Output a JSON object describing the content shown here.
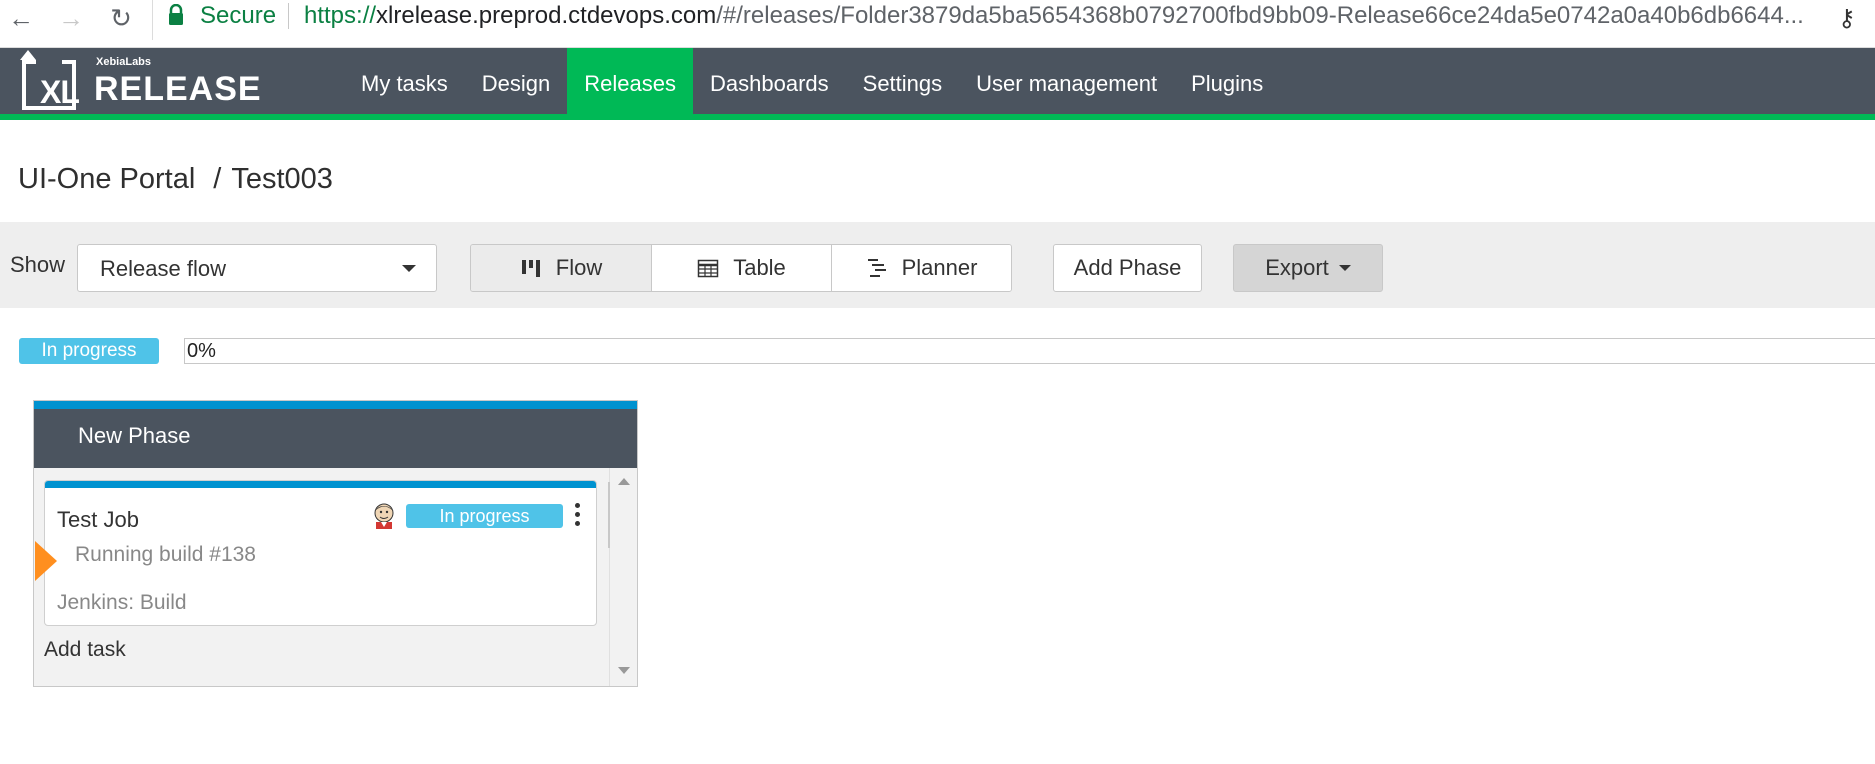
{
  "browser": {
    "secure_label": "Secure",
    "url_scheme": "https://",
    "url_host": "xlrelease.preprod.ctdevops.com",
    "url_path": "/#/releases/Folder3879da5ba5654368b0792700fbd9bb09-Release66ce24da5e0742a0a40b6db6644..."
  },
  "brand": {
    "small": "XebiaLabs",
    "logo_text": "XL",
    "big": "RELEASE"
  },
  "nav": {
    "items": [
      {
        "label": "My tasks"
      },
      {
        "label": "Design"
      },
      {
        "label": "Releases"
      },
      {
        "label": "Dashboards"
      },
      {
        "label": "Settings"
      },
      {
        "label": "User management"
      },
      {
        "label": "Plugins"
      }
    ],
    "active": "Releases"
  },
  "breadcrumb": {
    "folder": "UI-One Portal",
    "separator": "/",
    "release": "Test003"
  },
  "toolbar": {
    "show_label": "Show",
    "show_value": "Release flow",
    "views": [
      {
        "label": "Flow",
        "icon": "flow-icon"
      },
      {
        "label": "Table",
        "icon": "table-icon"
      },
      {
        "label": "Planner",
        "icon": "planner-icon"
      }
    ],
    "add_phase": "Add Phase",
    "export": "Export"
  },
  "release_status": {
    "status": "In progress",
    "progress": 0,
    "progress_label": "0%"
  },
  "phase": {
    "title": "New Phase",
    "tasks": [
      {
        "title": "Test Job",
        "status": "In progress",
        "detail": "Running build #138",
        "type": "Jenkins: Build"
      }
    ],
    "add_task": "Add task"
  },
  "colors": {
    "header_bg": "#4b545f",
    "accent_green": "#00b956",
    "status_blue": "#4fc3e8",
    "phase_blue": "#0092d0",
    "marker_orange": "#ff8f1f"
  }
}
